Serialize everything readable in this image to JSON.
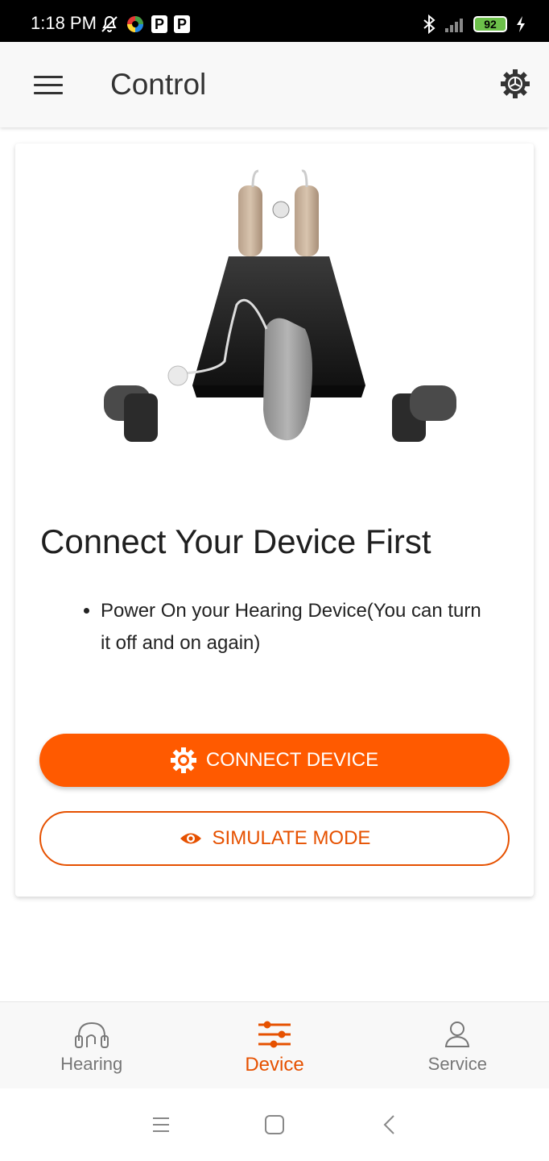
{
  "status_bar": {
    "time": "1:18 PM",
    "battery": "92",
    "p_icon_1": "P",
    "p_icon_2": "P"
  },
  "app_bar": {
    "title": "Control"
  },
  "card": {
    "title": "Connect Your Device First",
    "bullets": [
      "Power On your Hearing Device(You can turn it off and on again)"
    ],
    "connect_label": "CONNECT DEVICE",
    "simulate_label": "SIMULATE MODE"
  },
  "bottom_nav": {
    "items": [
      {
        "label": "Hearing",
        "icon": "headphones-icon",
        "active": false
      },
      {
        "label": "Device",
        "icon": "sliders-icon",
        "active": true
      },
      {
        "label": "Service",
        "icon": "person-icon",
        "active": false
      }
    ]
  },
  "colors": {
    "accent": "#ff5a00",
    "accent_text": "#e65100",
    "inactive": "#777777",
    "battery": "#6cc04a"
  },
  "icons": {
    "menu": "hamburger-menu-icon",
    "settings": "gear-icon",
    "connect": "gear-icon",
    "simulate": "eye-icon"
  }
}
